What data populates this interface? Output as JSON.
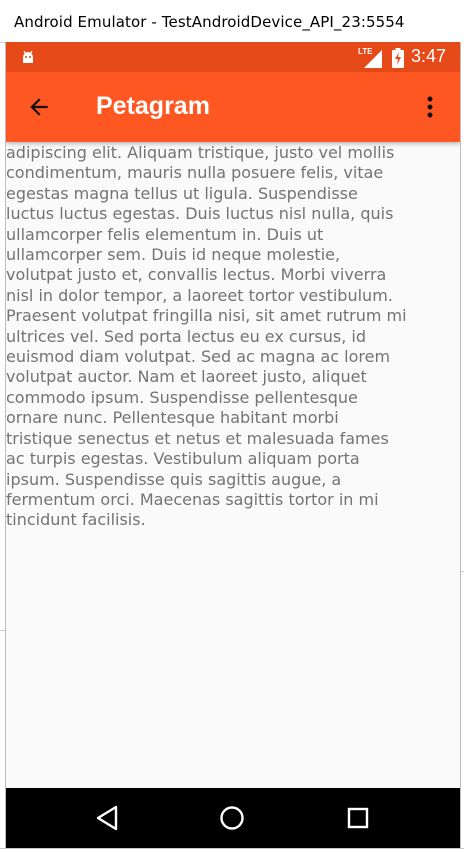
{
  "window": {
    "title": "Android Emulator - TestAndroidDevice_API_23:5554"
  },
  "status_bar": {
    "time": "3:47",
    "network_label": "LTE",
    "color": "#e64a19",
    "icons": [
      "android-notification-icon",
      "signal-icon",
      "battery-charging-icon"
    ]
  },
  "app_bar": {
    "title": "Petagram",
    "color": "#ff5722",
    "back_icon": "arrow-back-icon",
    "menu_icon": "overflow-menu-icon"
  },
  "content": {
    "text": "adipiscing elit. Aliquam tristique, justo vel mollis condimentum, mauris nulla posuere felis, vitae egestas magna tellus ut ligula. Suspendisse luctus luctus egestas. Duis luctus nisl nulla, quis ullamcorper felis elementum in. Duis ut ullamcorper sem. Duis id neque molestie, volutpat justo et, convallis lectus. Morbi viverra nisl in dolor tempor, a laoreet tortor vestibulum. Praesent volutpat fringilla nisi, sit amet rutrum mi ultrices vel. Sed porta lectus eu ex cursus, id euismod diam volutpat. Sed ac magna ac lorem volutpat auctor. Nam et laoreet justo, aliquet commodo ipsum. Suspendisse pellentesque ornare nunc. Pellentesque habitant morbi tristique senectus et netus et malesuada fames ac turpis egestas. Vestibulum aliquam porta ipsum. Suspendisse quis sagittis augue, a fermentum orci. Maecenas sagittis tortor in mi tincidunt facilisis."
  },
  "nav_bar": {
    "buttons": [
      "nav-back-icon",
      "nav-home-icon",
      "nav-recents-icon"
    ]
  }
}
